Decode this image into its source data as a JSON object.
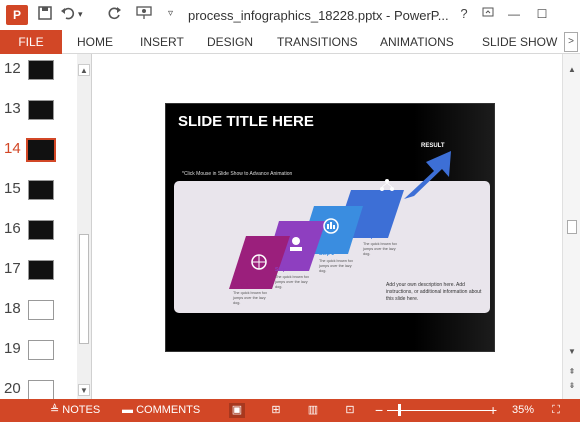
{
  "titlebar": {
    "app_logo": "P",
    "save_icon": "save-icon",
    "undo_icon": "undo-icon",
    "redo_icon": "redo-icon",
    "present_icon": "present-from-start-icon",
    "customize_icon": "customize-quick-access-icon",
    "title": "process_infographics_18228.pptx - PowerP...",
    "help": "?",
    "ribbon_options": "ribbon-display-options-icon",
    "minimize": "—",
    "maximize": "☐"
  },
  "ribbon": {
    "file": "FILE",
    "tabs": [
      "HOME",
      "INSERT",
      "DESIGN",
      "TRANSITIONS",
      "ANIMATIONS",
      "SLIDE SHOW"
    ],
    "scroll_right": ">"
  },
  "thumbnails": [
    {
      "num": "12",
      "style": "dark"
    },
    {
      "num": "13",
      "style": "dark"
    },
    {
      "num": "14",
      "style": "dark",
      "active": true
    },
    {
      "num": "15",
      "style": "dark"
    },
    {
      "num": "16",
      "style": "dark"
    },
    {
      "num": "17",
      "style": "dark"
    },
    {
      "num": "18",
      "style": "light"
    },
    {
      "num": "19",
      "style": "light"
    },
    {
      "num": "20",
      "style": "light"
    }
  ],
  "slide": {
    "title": "SLIDE TITLE HERE",
    "hint": "*Click Mouse in Slide Show to Advance Animation",
    "result": "RESULT",
    "description": "Add your own description here. Add instructions, or additional information about this slide here.",
    "steps": [
      {
        "label": "Step 1",
        "text": "The quick brown fox jumps over the lazy dog.",
        "color": "#9b1f7c"
      },
      {
        "label": "Step 1",
        "text": "The quick brown fox jumps over the lazy dog.",
        "color": "#8e3fc0"
      },
      {
        "label": "Step 1",
        "text": "The quick brown fox jumps over the lazy dog.",
        "color": "#3a8de0"
      },
      {
        "label": "Step 1",
        "text": "The quick brown fox jumps over the lazy dog.",
        "color": "#3d6fd6"
      }
    ]
  },
  "statusbar": {
    "notes": "NOTES",
    "comments": "COMMENTS",
    "zoom_minus": "−",
    "zoom_plus": "+",
    "zoom": "35%",
    "view_icons": [
      "normal-view-icon",
      "slide-sorter-icon",
      "reading-view-icon",
      "slideshow-icon"
    ],
    "fit_icon": "fit-slide-icon"
  },
  "colors": {
    "accent": "#d24726"
  }
}
